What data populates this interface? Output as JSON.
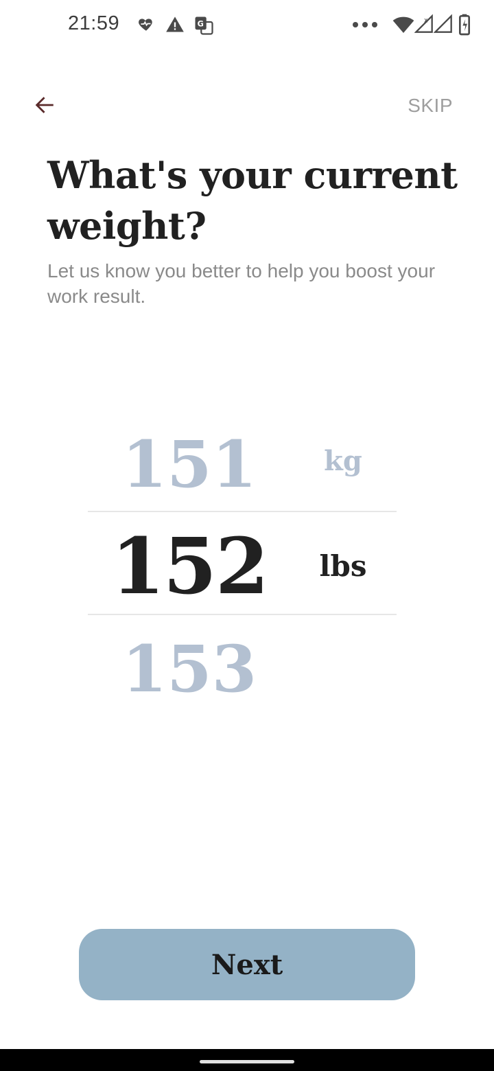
{
  "status_bar": {
    "time": "21:59",
    "icons_left": [
      "heart-pulse-icon",
      "warning-icon",
      "translate-icon"
    ],
    "icons_right": [
      "more-dots-icon",
      "wifi-icon",
      "signal-icon",
      "signal-x-icon",
      "battery-icon"
    ]
  },
  "nav": {
    "back_icon": "arrow-left-icon",
    "skip_label": "SKIP"
  },
  "header": {
    "title": "What's your current weight?",
    "subtitle": "Let us know you better to help you boost your work result."
  },
  "picker": {
    "values": {
      "previous": "151",
      "selected": "152",
      "next": "153"
    },
    "units": {
      "previous": "kg",
      "selected": "lbs"
    }
  },
  "footer": {
    "next_label": "Next"
  },
  "colors": {
    "accent_button": "#94b2c6",
    "muted_number": "#b3c0d1",
    "primary_text": "#212121",
    "back_arrow": "#5a2a2a"
  }
}
